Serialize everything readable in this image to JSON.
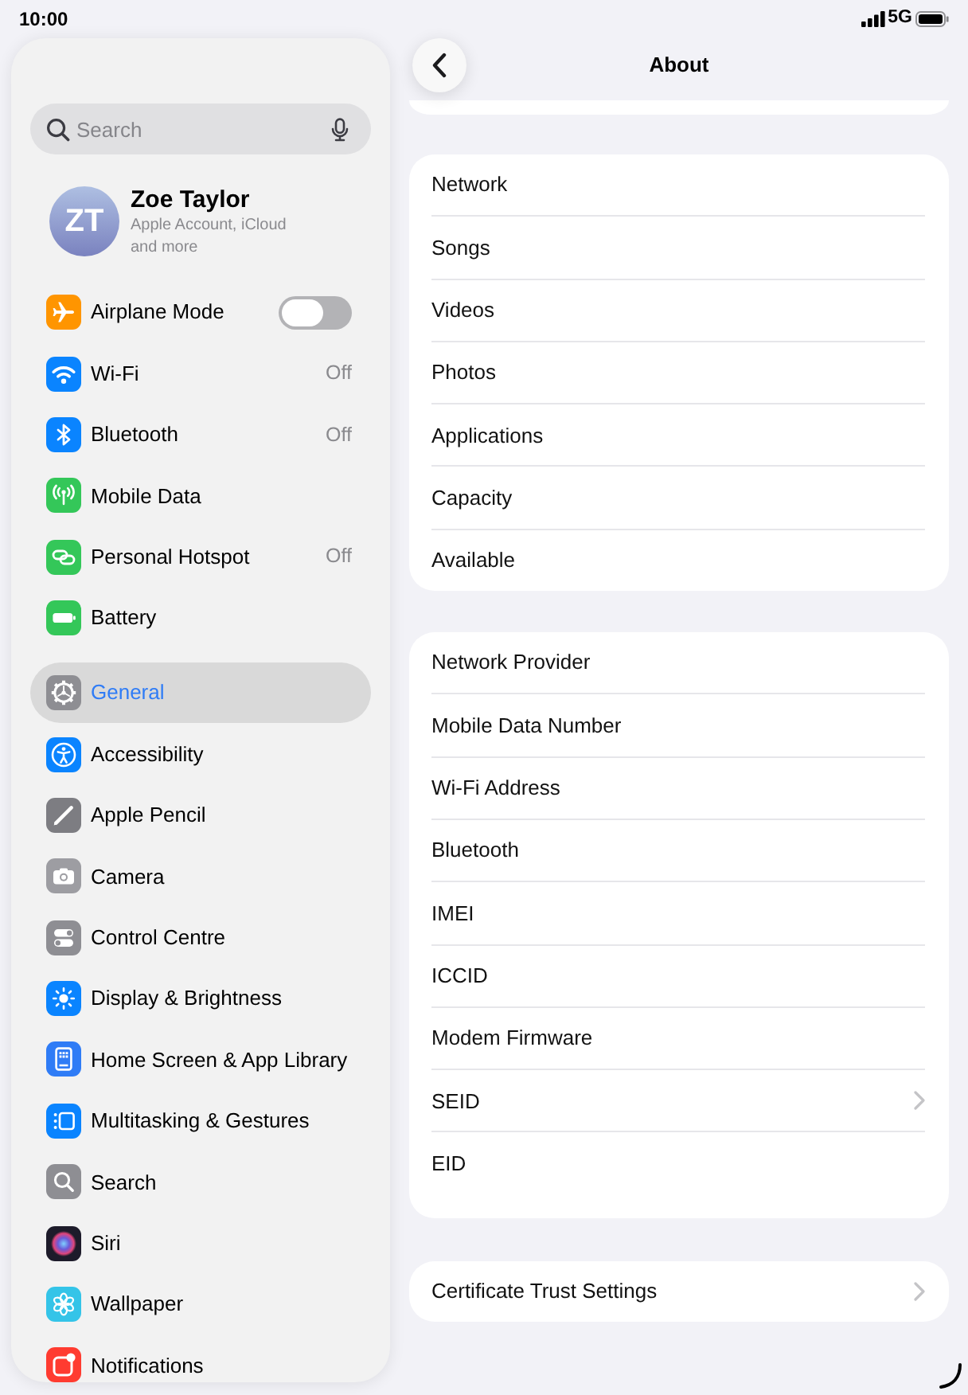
{
  "status_bar": {
    "time": "10:00",
    "network": "5G"
  },
  "sidebar": {
    "search": {
      "placeholder": "Search"
    },
    "profile": {
      "initials": "ZT",
      "name": "Zoe Taylor",
      "subtitle": "Apple Account, iCloud and more"
    },
    "groups": [
      {
        "items": [
          {
            "kind": "toggle",
            "label": "Airplane Mode",
            "on": false,
            "selected": false
          },
          {
            "kind": "value",
            "label": "Wi-Fi",
            "value": "Off",
            "selected": false
          },
          {
            "kind": "value",
            "label": "Bluetooth",
            "value": "Off",
            "selected": false
          },
          {
            "kind": "plain",
            "label": "Mobile Data",
            "selected": false
          },
          {
            "kind": "value",
            "label": "Personal Hotspot",
            "value": "Off",
            "selected": false
          },
          {
            "kind": "plain",
            "label": "Battery",
            "selected": false
          }
        ]
      },
      {
        "items": [
          {
            "kind": "plain",
            "label": "General",
            "selected": true
          },
          {
            "kind": "plain",
            "label": "Accessibility",
            "selected": false
          },
          {
            "kind": "plain",
            "label": "Apple Pencil",
            "selected": false
          },
          {
            "kind": "plain",
            "label": "Camera",
            "selected": false
          },
          {
            "kind": "plain",
            "label": "Control Centre",
            "selected": false
          },
          {
            "kind": "plain",
            "label": "Display & Brightness",
            "selected": false
          },
          {
            "kind": "plain",
            "label": "Home Screen & App Library",
            "selected": false
          },
          {
            "kind": "plain",
            "label": "Multitasking & Gestures",
            "selected": false
          },
          {
            "kind": "plain",
            "label": "Search",
            "selected": false
          },
          {
            "kind": "plain",
            "label": "Siri",
            "selected": false
          },
          {
            "kind": "plain",
            "label": "Wallpaper",
            "selected": false
          },
          {
            "kind": "plain",
            "label": "Notifications",
            "selected": false
          }
        ]
      }
    ]
  },
  "detail": {
    "title": "About",
    "sections": [
      {
        "rows": [
          {
            "kind": "info",
            "label": "Network"
          },
          {
            "kind": "info",
            "label": "Songs"
          },
          {
            "kind": "info",
            "label": "Videos"
          },
          {
            "kind": "info",
            "label": "Photos"
          },
          {
            "kind": "info",
            "label": "Applications"
          },
          {
            "kind": "info",
            "label": "Capacity"
          },
          {
            "kind": "info",
            "label": "Available"
          }
        ]
      },
      {
        "rows": [
          {
            "kind": "info",
            "label": "Network Provider"
          },
          {
            "kind": "info",
            "label": "Mobile Data Number"
          },
          {
            "kind": "info",
            "label": "Wi-Fi Address"
          },
          {
            "kind": "info",
            "label": "Bluetooth"
          },
          {
            "kind": "info",
            "label": "IMEI"
          },
          {
            "kind": "info",
            "label": "ICCID"
          },
          {
            "kind": "info",
            "label": "Modem Firmware"
          },
          {
            "kind": "link",
            "label": "SEID"
          },
          {
            "kind": "info",
            "label": "EID"
          }
        ]
      },
      {
        "rows": [
          {
            "kind": "link",
            "label": "Certificate Trust Settings"
          }
        ]
      }
    ]
  }
}
